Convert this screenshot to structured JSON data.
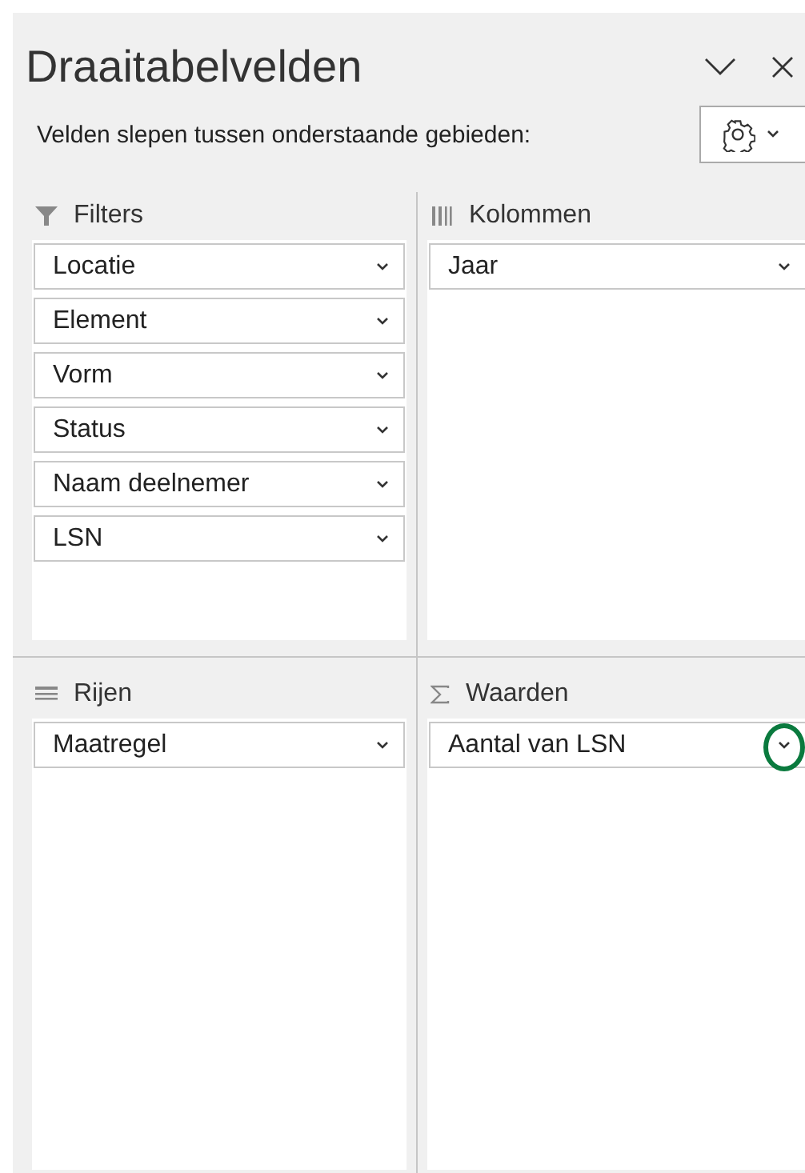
{
  "window": {
    "title": "Draaitabelvelden"
  },
  "subtitle": "Velden slepen tussen onderstaande gebieden:",
  "areas": [
    {
      "kind": "filters",
      "title": "Filters",
      "fields": [
        {
          "label": "Locatie",
          "highlighted": false
        },
        {
          "label": "Element",
          "highlighted": false
        },
        {
          "label": "Vorm",
          "highlighted": false
        },
        {
          "label": "Status",
          "highlighted": false
        },
        {
          "label": "Naam deelnemer",
          "highlighted": false
        },
        {
          "label": "LSN",
          "highlighted": false
        }
      ]
    },
    {
      "kind": "columns",
      "title": "Kolommen",
      "fields": [
        {
          "label": "Jaar",
          "highlighted": false
        }
      ]
    },
    {
      "kind": "rows",
      "title": "Rijen",
      "fields": [
        {
          "label": "Maatregel",
          "highlighted": false
        }
      ]
    },
    {
      "kind": "values",
      "title": "Waarden",
      "fields": [
        {
          "label": "Aantal van LSN",
          "highlighted": true
        }
      ]
    }
  ]
}
